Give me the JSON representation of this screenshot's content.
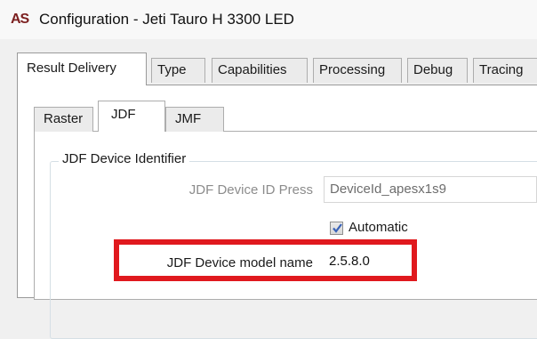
{
  "window": {
    "icon_label": "AS",
    "title": "Configuration - Jeti Tauro H 3300 LED"
  },
  "top_tabs": [
    "Result Delivery",
    "Type",
    "Capabilities",
    "Processing",
    "Debug",
    "Tracing"
  ],
  "active_top_tab": "Result Delivery",
  "sub_tabs": [
    "Raster",
    "JDF",
    "JMF"
  ],
  "active_sub_tab": "JDF",
  "group": {
    "title": "JDF Device Identifier",
    "device_id_label": "JDF Device ID Press",
    "device_id_value": "DeviceId_apesx1s9",
    "automatic_label": "Automatic",
    "automatic_checked": true,
    "model_name_label": "JDF Device model name",
    "model_name_value": "2.5.8.0"
  },
  "colors": {
    "highlight": "#e0191e",
    "checkmark": "#3a63b8"
  }
}
